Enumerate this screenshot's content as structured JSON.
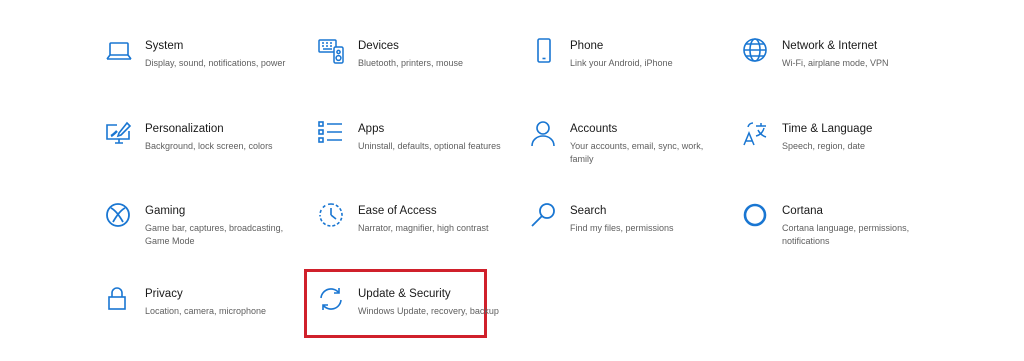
{
  "accent_color": "#1976d2",
  "highlight_color": "#d0202b",
  "tiles": [
    {
      "id": "system",
      "icon": "laptop-icon",
      "title": "System",
      "desc": "Display, sound, notifications, power"
    },
    {
      "id": "devices",
      "icon": "keyboard-icon",
      "title": "Devices",
      "desc": "Bluetooth, printers, mouse"
    },
    {
      "id": "phone",
      "icon": "phone-icon",
      "title": "Phone",
      "desc": "Link your Android, iPhone"
    },
    {
      "id": "network",
      "icon": "globe-icon",
      "title": "Network & Internet",
      "desc": "Wi-Fi, airplane mode, VPN"
    },
    {
      "id": "personalization",
      "icon": "paintbrush-icon",
      "title": "Personalization",
      "desc": "Background, lock screen, colors"
    },
    {
      "id": "apps",
      "icon": "apps-list-icon",
      "title": "Apps",
      "desc": "Uninstall, defaults, optional features"
    },
    {
      "id": "accounts",
      "icon": "person-icon",
      "title": "Accounts",
      "desc": "Your accounts, email, sync, work, family"
    },
    {
      "id": "time-language",
      "icon": "language-icon",
      "title": "Time & Language",
      "desc": "Speech, region, date"
    },
    {
      "id": "gaming",
      "icon": "xbox-icon",
      "title": "Gaming",
      "desc": "Game bar, captures, broadcasting, Game Mode"
    },
    {
      "id": "ease-of-access",
      "icon": "ease-of-access-icon",
      "title": "Ease of Access",
      "desc": "Narrator, magnifier, high contrast"
    },
    {
      "id": "search",
      "icon": "search-icon",
      "title": "Search",
      "desc": "Find my files, permissions"
    },
    {
      "id": "cortana",
      "icon": "cortana-icon",
      "title": "Cortana",
      "desc": "Cortana language, permissions, notifications"
    },
    {
      "id": "privacy",
      "icon": "lock-icon",
      "title": "Privacy",
      "desc": "Location, camera, microphone"
    },
    {
      "id": "update-security",
      "icon": "sync-icon",
      "title": "Update & Security",
      "desc": "Windows Update, recovery, backup",
      "highlighted": true
    }
  ]
}
